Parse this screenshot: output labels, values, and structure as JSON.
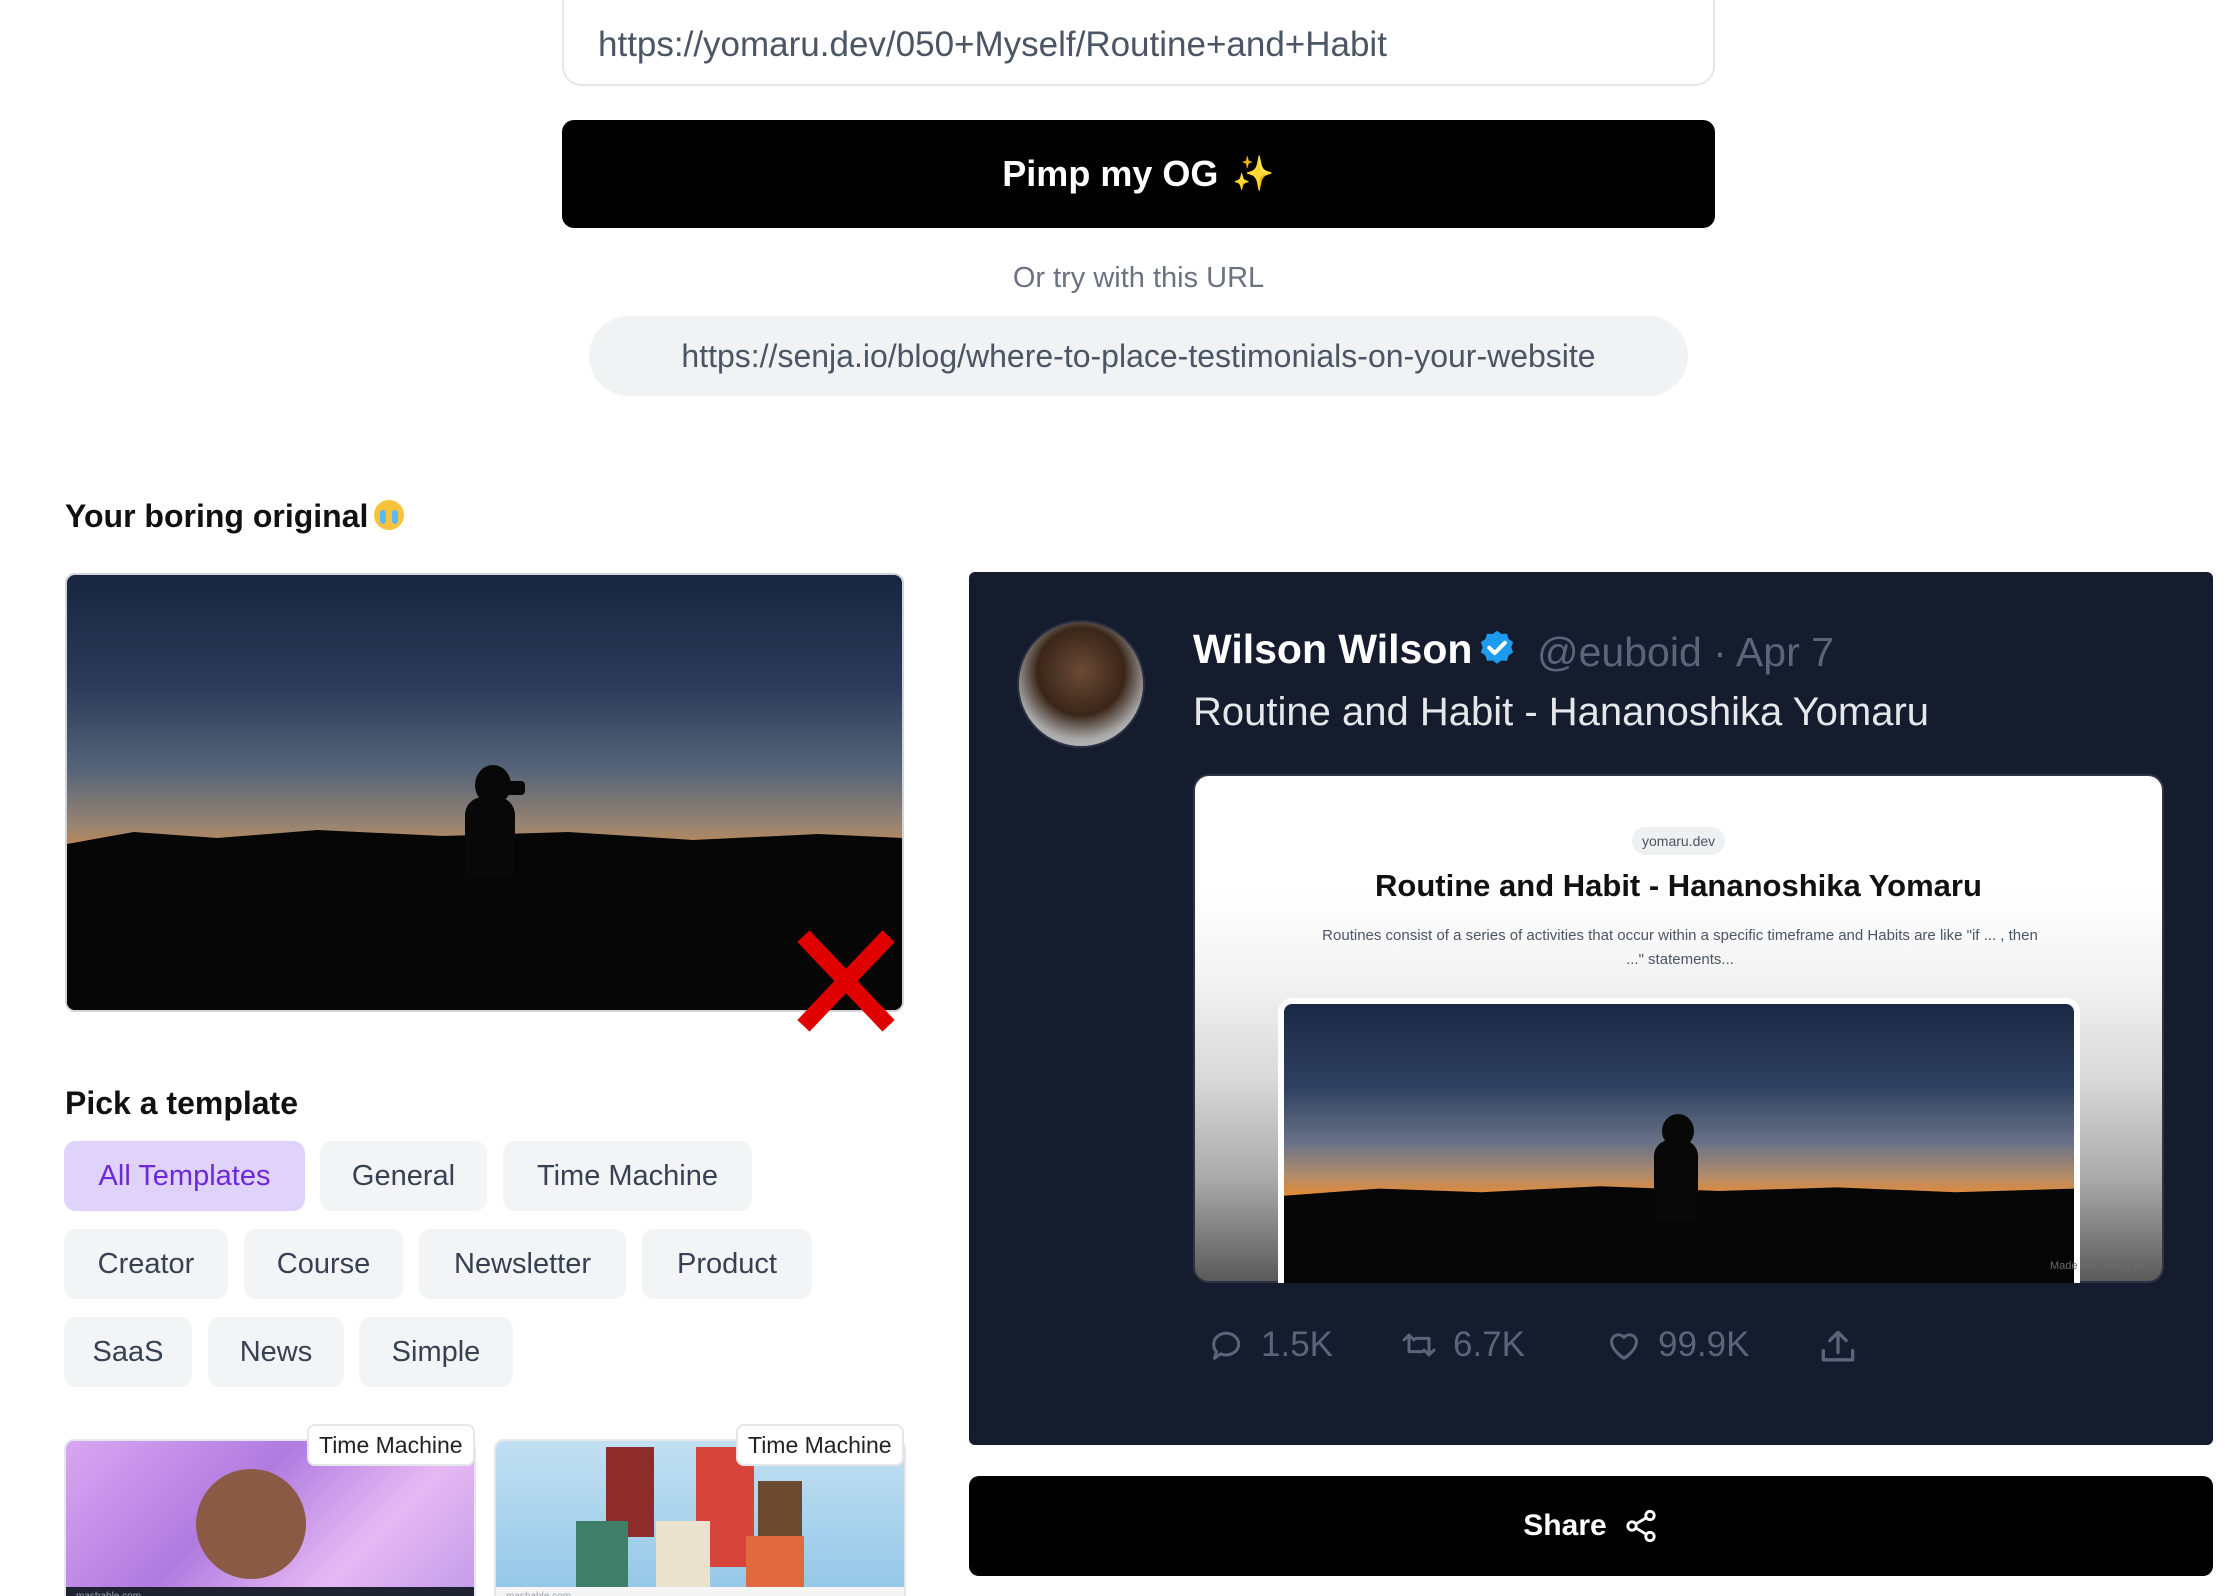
{
  "url_input": {
    "value": "https://yomaru.dev/050+Myself/Routine+and+Habit"
  },
  "submit": {
    "label": "Pimp my OG",
    "icon": "sparkles-icon"
  },
  "try_url": {
    "label": "Or try with this URL",
    "url": "https://senja.io/blog/where-to-place-testimonials-on-your-website"
  },
  "original": {
    "title": "Your boring original",
    "title_emoji": "crying-face-icon"
  },
  "templates": {
    "title": "Pick a template",
    "filters": [
      {
        "label": "All Templates",
        "active": true
      },
      {
        "label": "General"
      },
      {
        "label": "Time Machine"
      },
      {
        "label": "Creator"
      },
      {
        "label": "Course"
      },
      {
        "label": "Newsletter"
      },
      {
        "label": "Product"
      },
      {
        "label": "SaaS"
      },
      {
        "label": "News"
      },
      {
        "label": "Simple"
      }
    ],
    "thumbnails": [
      {
        "badge": "Time Machine",
        "footer": "mashable.com"
      },
      {
        "badge": "Time Machine",
        "footer": "mashable.com"
      }
    ]
  },
  "tweet": {
    "name": "Wilson Wilson",
    "handle_date": "@euboid · Apr 7",
    "text": "Routine and Habit - Hananoshika Yomaru",
    "og": {
      "domain": "yomaru.dev",
      "title": "Routine and Habit - Hananoshika Yomaru",
      "description": "Routines consist of a series of activities that occur within a specific timeframe and Habits are like \"if ... , then ...\" statements...",
      "watermark": "Made with theog.io"
    },
    "stats": {
      "replies": "1.5K",
      "retweets": "6.7K",
      "likes": "99.9K"
    }
  },
  "share": {
    "label": "Share",
    "icon": "share-icon"
  },
  "colors": {
    "tweet_bg": "#151c2d",
    "accent_purple": "#6d28d9",
    "chip_active_bg": "#dfd2fb",
    "verified_blue": "#1d9bf0",
    "reject_red": "#e00000"
  }
}
